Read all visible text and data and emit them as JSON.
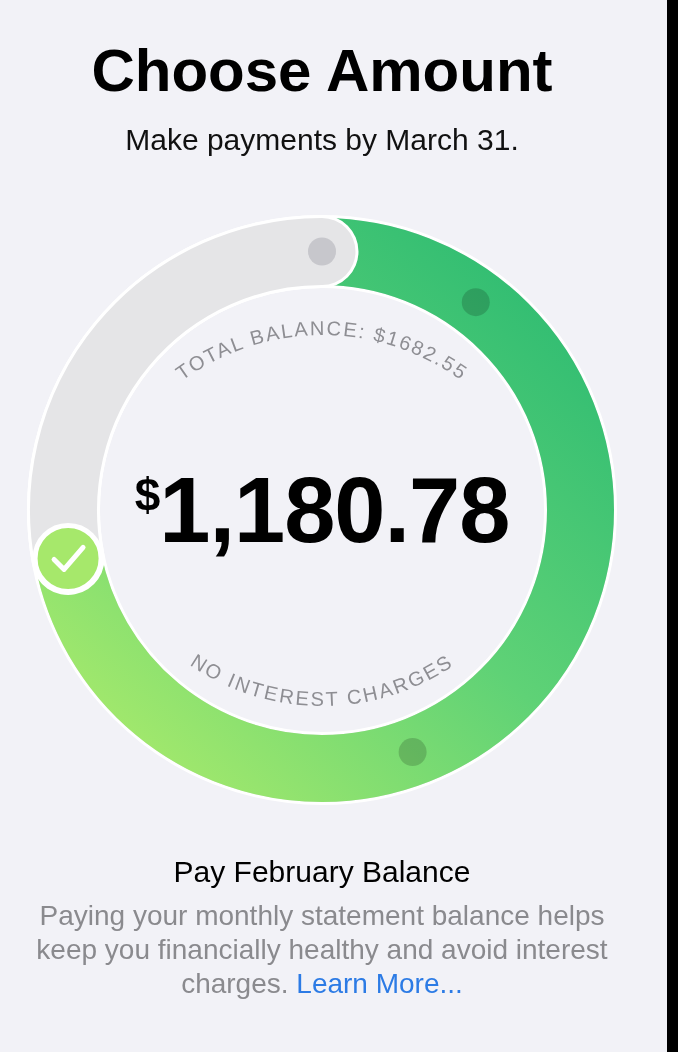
{
  "header": {
    "title": "Choose Amount",
    "subtitle": "Make payments by March 31."
  },
  "dial": {
    "top_label": "TOTAL BALANCE: $1682.55",
    "amount": "$^{$}$1,180.78",
    "bottom_label": "NO INTEREST CHARGES",
    "level": 0.72
  },
  "option": {
    "title": "Pay February Balance",
    "description": "Paying your monthly statement balance helps keep you financially healthy and avoid interest charges.",
    "link": "Learn More..."
  }
}
